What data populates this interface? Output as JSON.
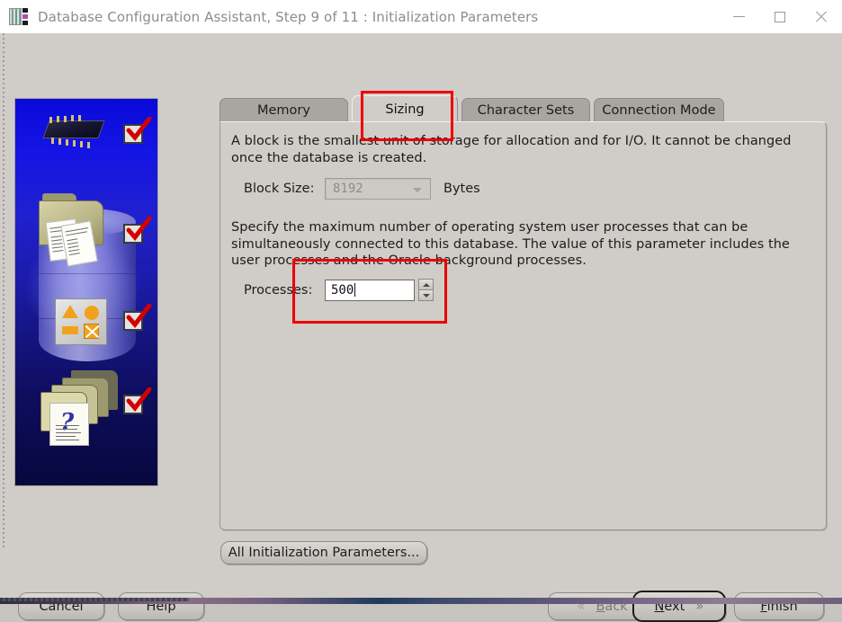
{
  "window": {
    "title": "Database Configuration Assistant, Step 9 of 11 : Initialization Parameters",
    "icon": "database-chip-icon",
    "controls": {
      "minimize": "minimize-icon",
      "maximize": "maximize-icon",
      "close": "close-icon"
    }
  },
  "banner": {
    "alt": "oracle-database-wizard-illustration",
    "icons": [
      "chip-icon",
      "folder-documents-icon",
      "shapes-icon",
      "folders-question-icon"
    ],
    "checkmarks": 4
  },
  "tabs": [
    {
      "label": "Memory",
      "selected": false
    },
    {
      "label": "Sizing",
      "selected": true
    },
    {
      "label": "Character Sets",
      "selected": false
    },
    {
      "label": "Connection Mode",
      "selected": false
    }
  ],
  "panel": {
    "block_paragraph": "A block is the smallest unit of storage for allocation and for I/O. It cannot be changed once the database is created.",
    "block_size": {
      "label": "Block Size:",
      "value": "8192",
      "units": "Bytes",
      "enabled": false
    },
    "processes_paragraph": "Specify the maximum number of operating system user processes that can be simultaneously connected to this database. The value of this parameter includes the user processes and the Oracle background processes.",
    "processes": {
      "label": "Processes:",
      "value": "500",
      "focused": true
    },
    "all_parameters_button": "All Initialization Parameters..."
  },
  "footer": {
    "cancel": "Cancel",
    "help": "Help",
    "back": "Back",
    "back_chevron": "«",
    "back_enabled": false,
    "next": "Next",
    "next_chevron": "»",
    "next_focused": true,
    "finish": "Finish"
  },
  "annotations": {
    "accent_color": "#ee0000",
    "highlighted": [
      "Sizing tab",
      "Processes field"
    ]
  }
}
